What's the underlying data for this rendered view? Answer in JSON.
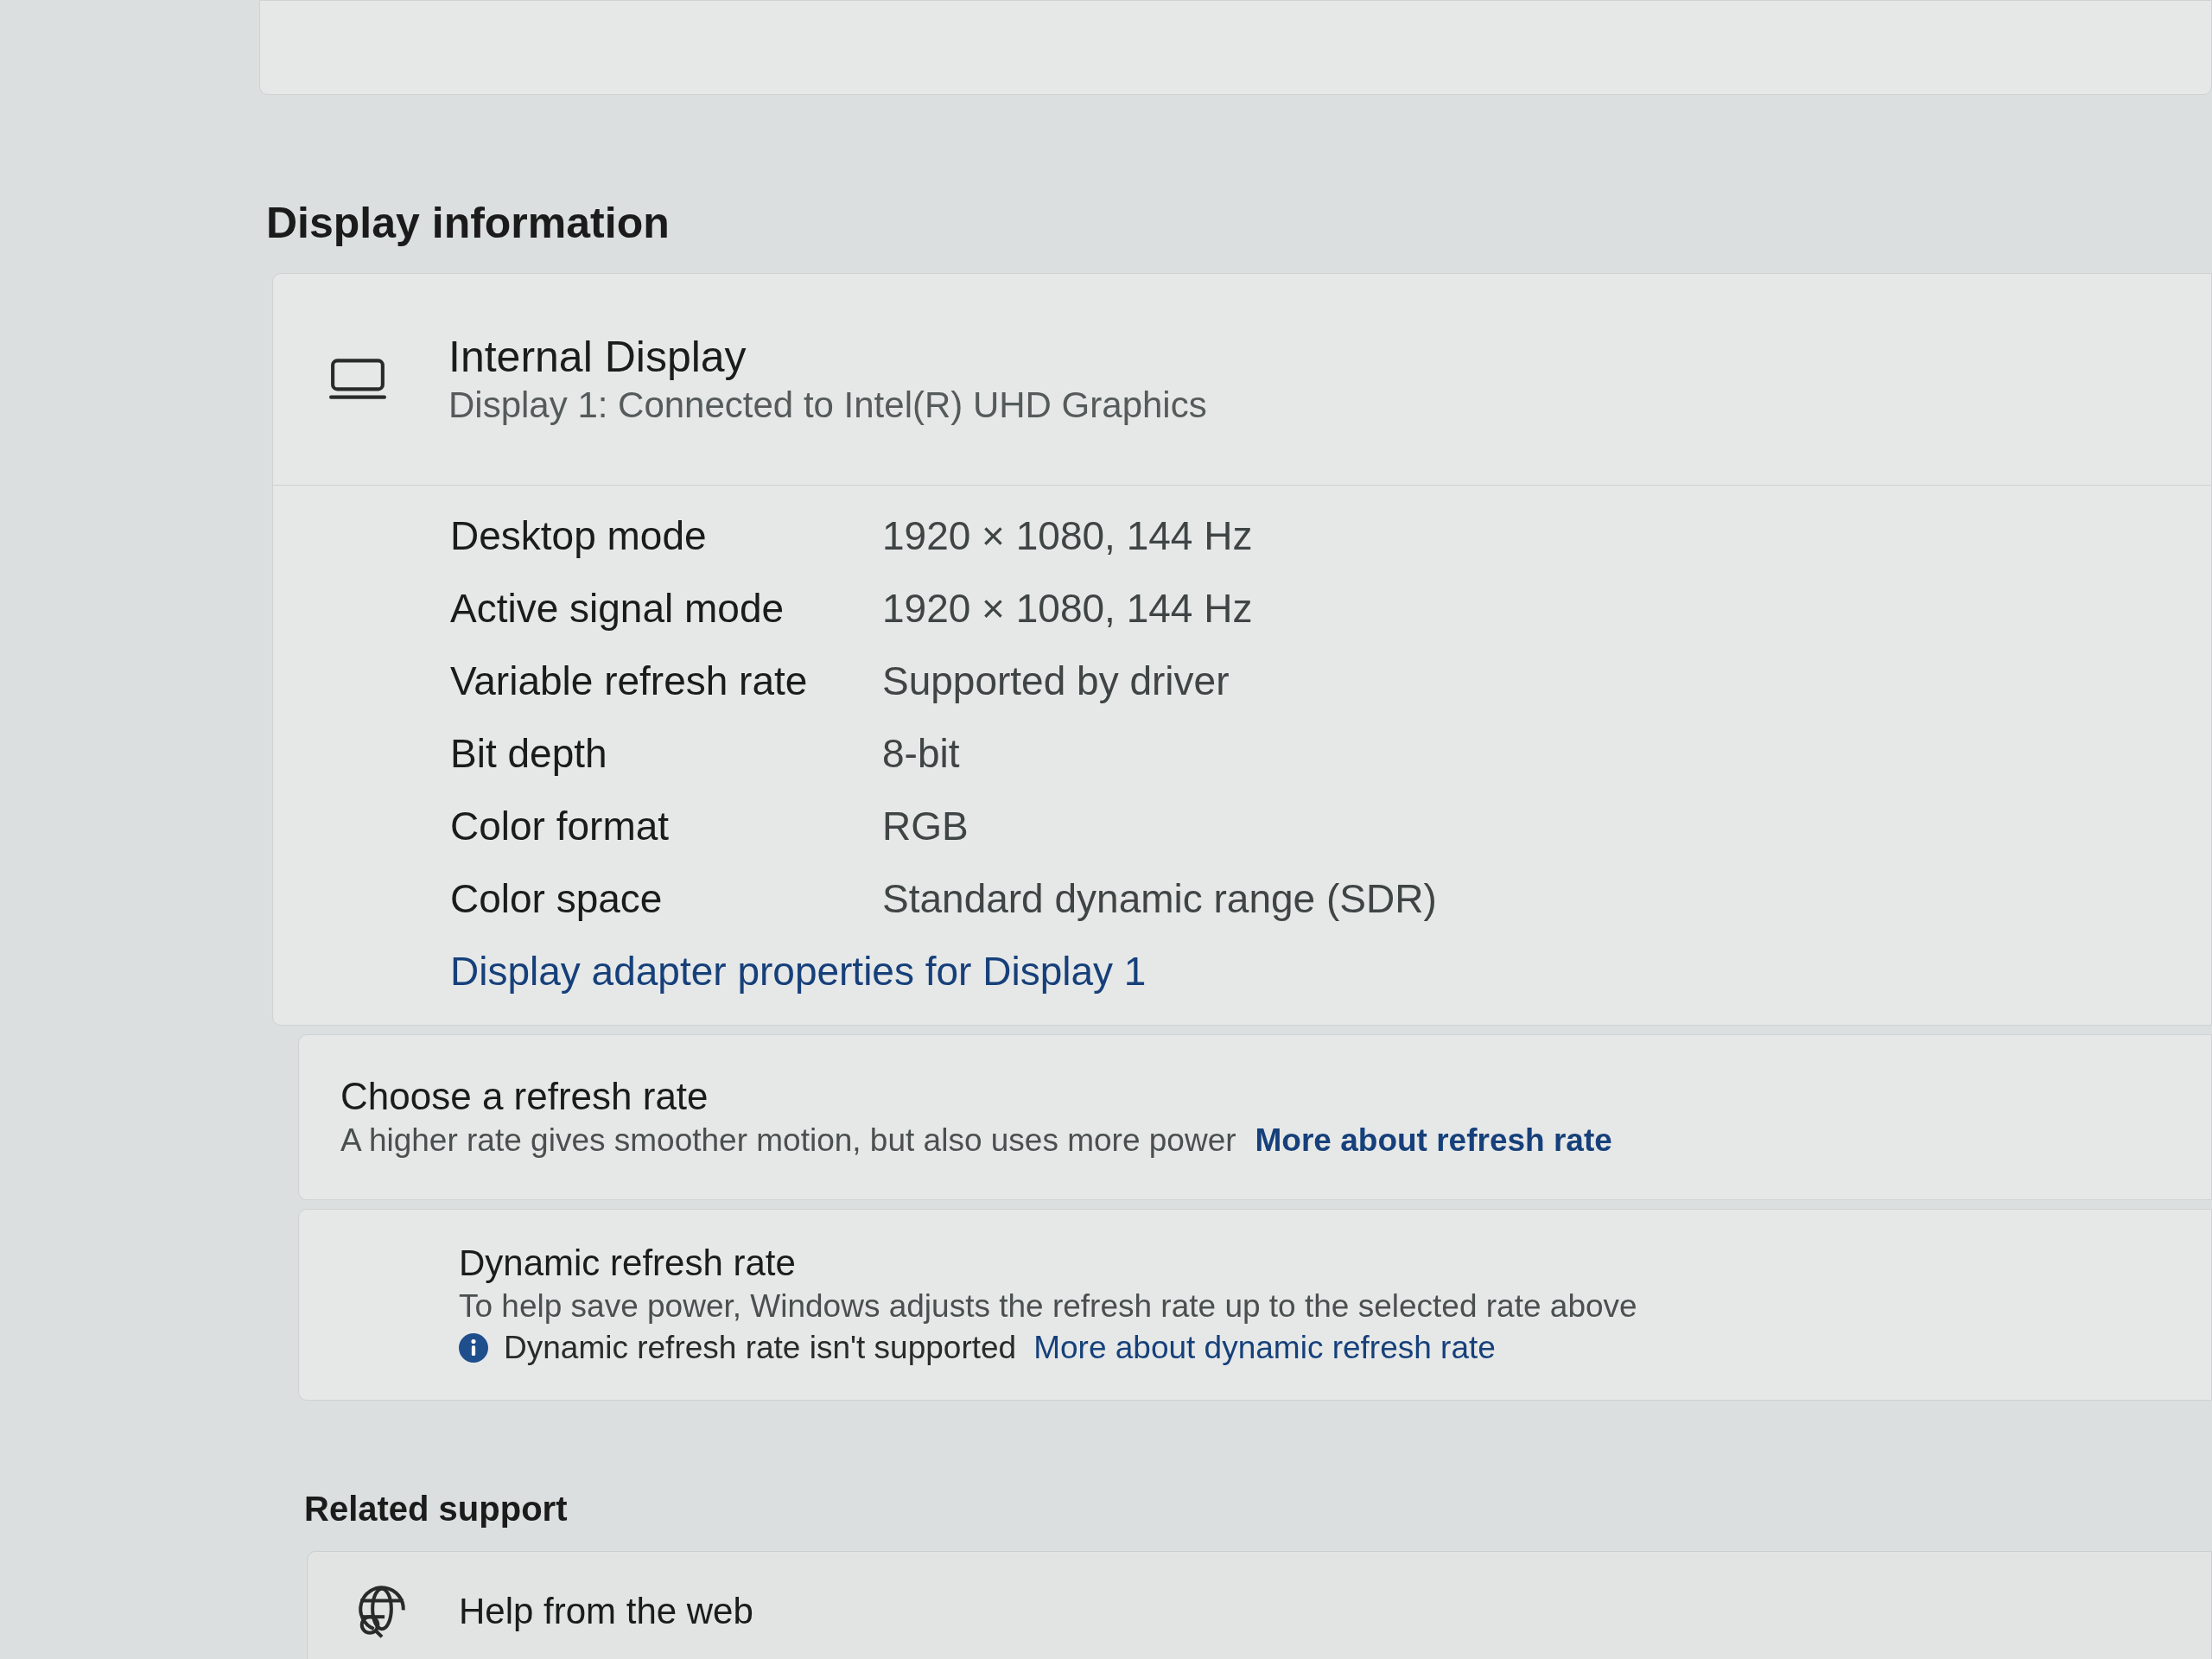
{
  "section_title": "Display information",
  "display": {
    "title": "Internal Display",
    "subtitle": "Display 1: Connected to Intel(R) UHD Graphics",
    "properties": [
      {
        "label": "Desktop mode",
        "value": "1920 × 1080, 144 Hz"
      },
      {
        "label": "Active signal mode",
        "value": "1920 × 1080, 144 Hz"
      },
      {
        "label": "Variable refresh rate",
        "value": "Supported by driver"
      },
      {
        "label": "Bit depth",
        "value": "8-bit"
      },
      {
        "label": "Color format",
        "value": "RGB"
      },
      {
        "label": "Color space",
        "value": "Standard dynamic range (SDR)"
      }
    ],
    "link": "Display adapter properties for Display 1"
  },
  "refresh_rate": {
    "title": "Choose a refresh rate",
    "description": "A higher rate gives smoother motion, but also uses more power",
    "link": "More about refresh rate"
  },
  "dynamic_refresh_rate": {
    "title": "Dynamic refresh rate",
    "description": "To help save power, Windows adjusts the refresh rate up to the selected rate above",
    "notice": "Dynamic refresh rate isn't supported",
    "link": "More about dynamic refresh rate"
  },
  "related_support": {
    "title": "Related support",
    "items": [
      {
        "label": "Help from the web"
      }
    ]
  }
}
